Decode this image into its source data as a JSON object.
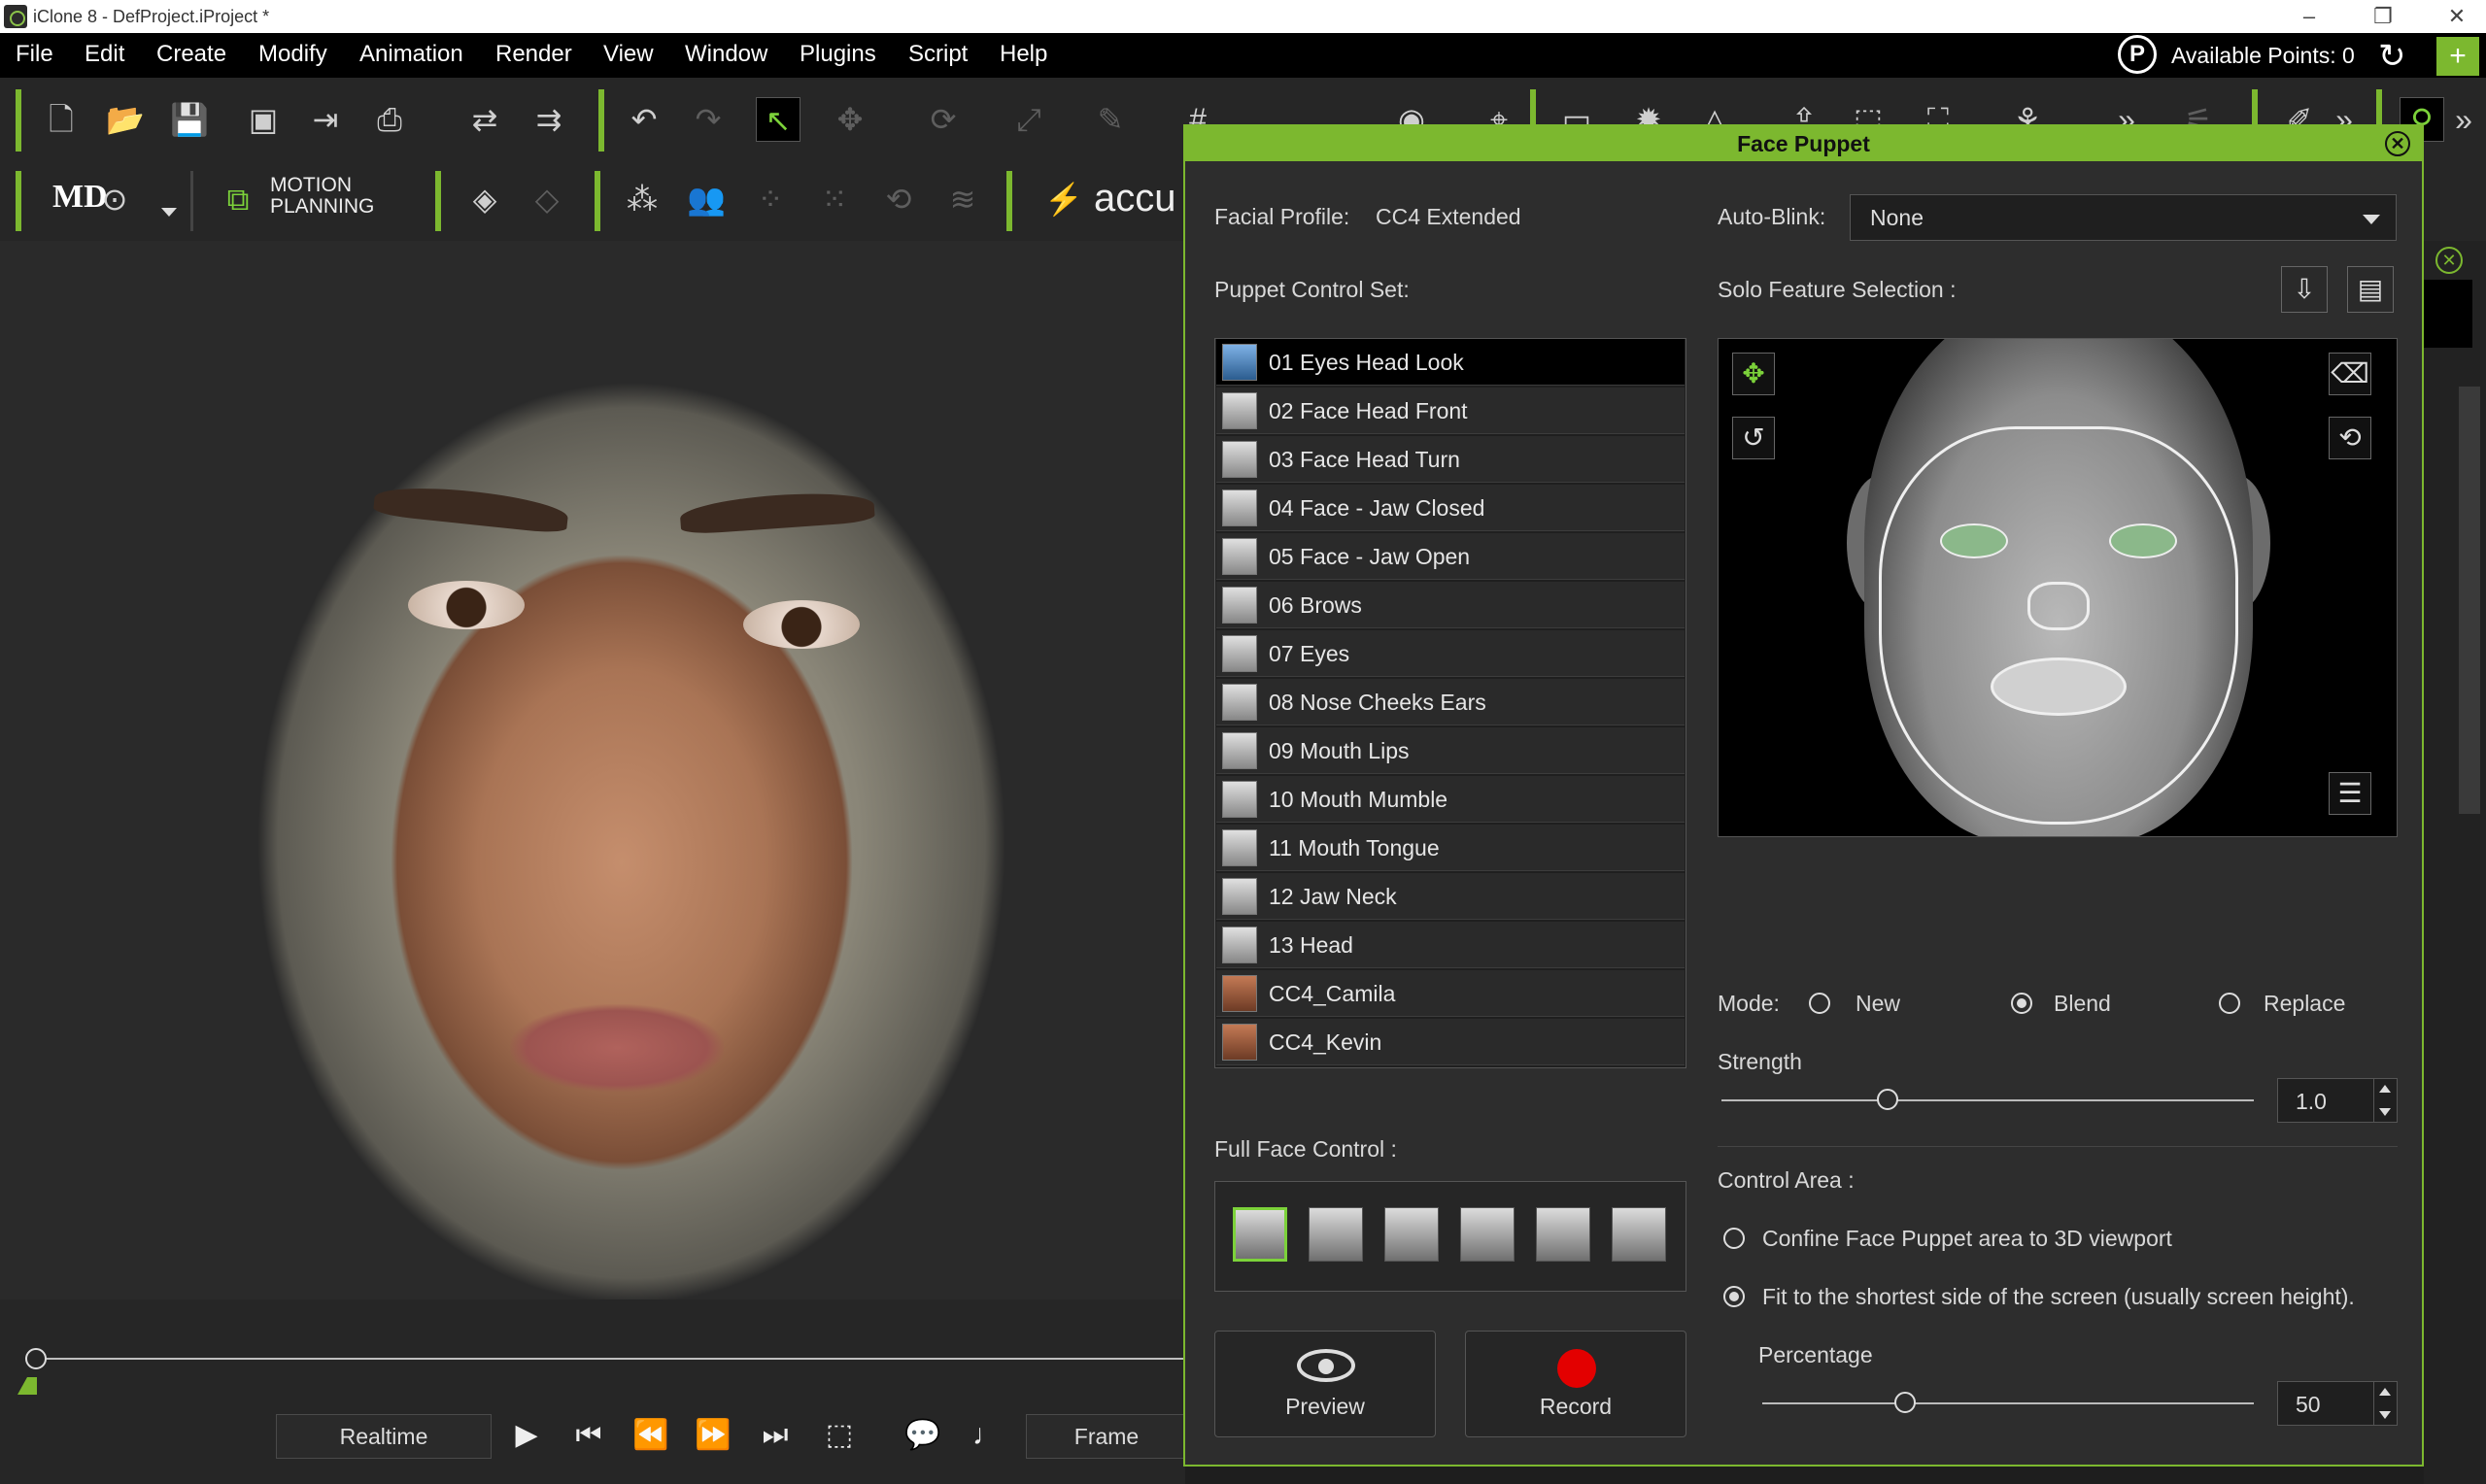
{
  "titlebar": {
    "title": "iClone 8 - DefProject.iProject *",
    "minimize": "–",
    "restore": "❐",
    "close": "✕"
  },
  "menu": [
    "File",
    "Edit",
    "Create",
    "Modify",
    "Animation",
    "Render",
    "View",
    "Window",
    "Plugins",
    "Script",
    "Help"
  ],
  "points": {
    "badge": "P",
    "label": "Available Points: 0",
    "refresh": "↻",
    "add": "+"
  },
  "toolbar2": {
    "motion_planning_line1": "MOTION",
    "motion_planning_line2": "PLANNING",
    "accu": "accu",
    "md": "MD"
  },
  "timeline": {
    "realtime": "Realtime",
    "frame": "Frame"
  },
  "face_puppet": {
    "title": "Face Puppet",
    "facial_profile_label": "Facial Profile:",
    "facial_profile_value": "CC4 Extended",
    "auto_blink_label": "Auto-Blink:",
    "auto_blink_value": "None",
    "puppet_control_set_label": "Puppet Control Set:",
    "solo_feature_label": "Solo Feature Selection :",
    "control_sets": [
      "01 Eyes Head Look",
      "02 Face Head Front",
      "03 Face Head Turn",
      "04 Face - Jaw Closed",
      "05 Face - Jaw Open",
      "06 Brows",
      "07 Eyes",
      "08 Nose Cheeks Ears",
      "09 Mouth Lips",
      "10 Mouth Mumble",
      "11 Mouth Tongue",
      "12 Jaw Neck",
      "13 Head",
      "CC4_Camila",
      "CC4_Kevin"
    ],
    "mode_label": "Mode:",
    "mode_new": "New",
    "mode_blend": "Blend",
    "mode_replace": "Replace",
    "mode_selected": "Blend",
    "strength_label": "Strength",
    "strength_value": "1.0",
    "strength_fraction": 0.31,
    "control_area_label": "Control Area :",
    "control_area_opt1": "Confine Face Puppet area to 3D viewport",
    "control_area_opt2": "Fit to the shortest side of the screen (usually screen height).",
    "percentage_label": "Percentage",
    "percentage_value": "50",
    "percentage_fraction": 0.3,
    "full_face_label": "Full Face Control :",
    "preview_label": "Preview",
    "record_label": "Record"
  },
  "colors": {
    "accent": "#7cb82f",
    "record": "#e30000"
  }
}
